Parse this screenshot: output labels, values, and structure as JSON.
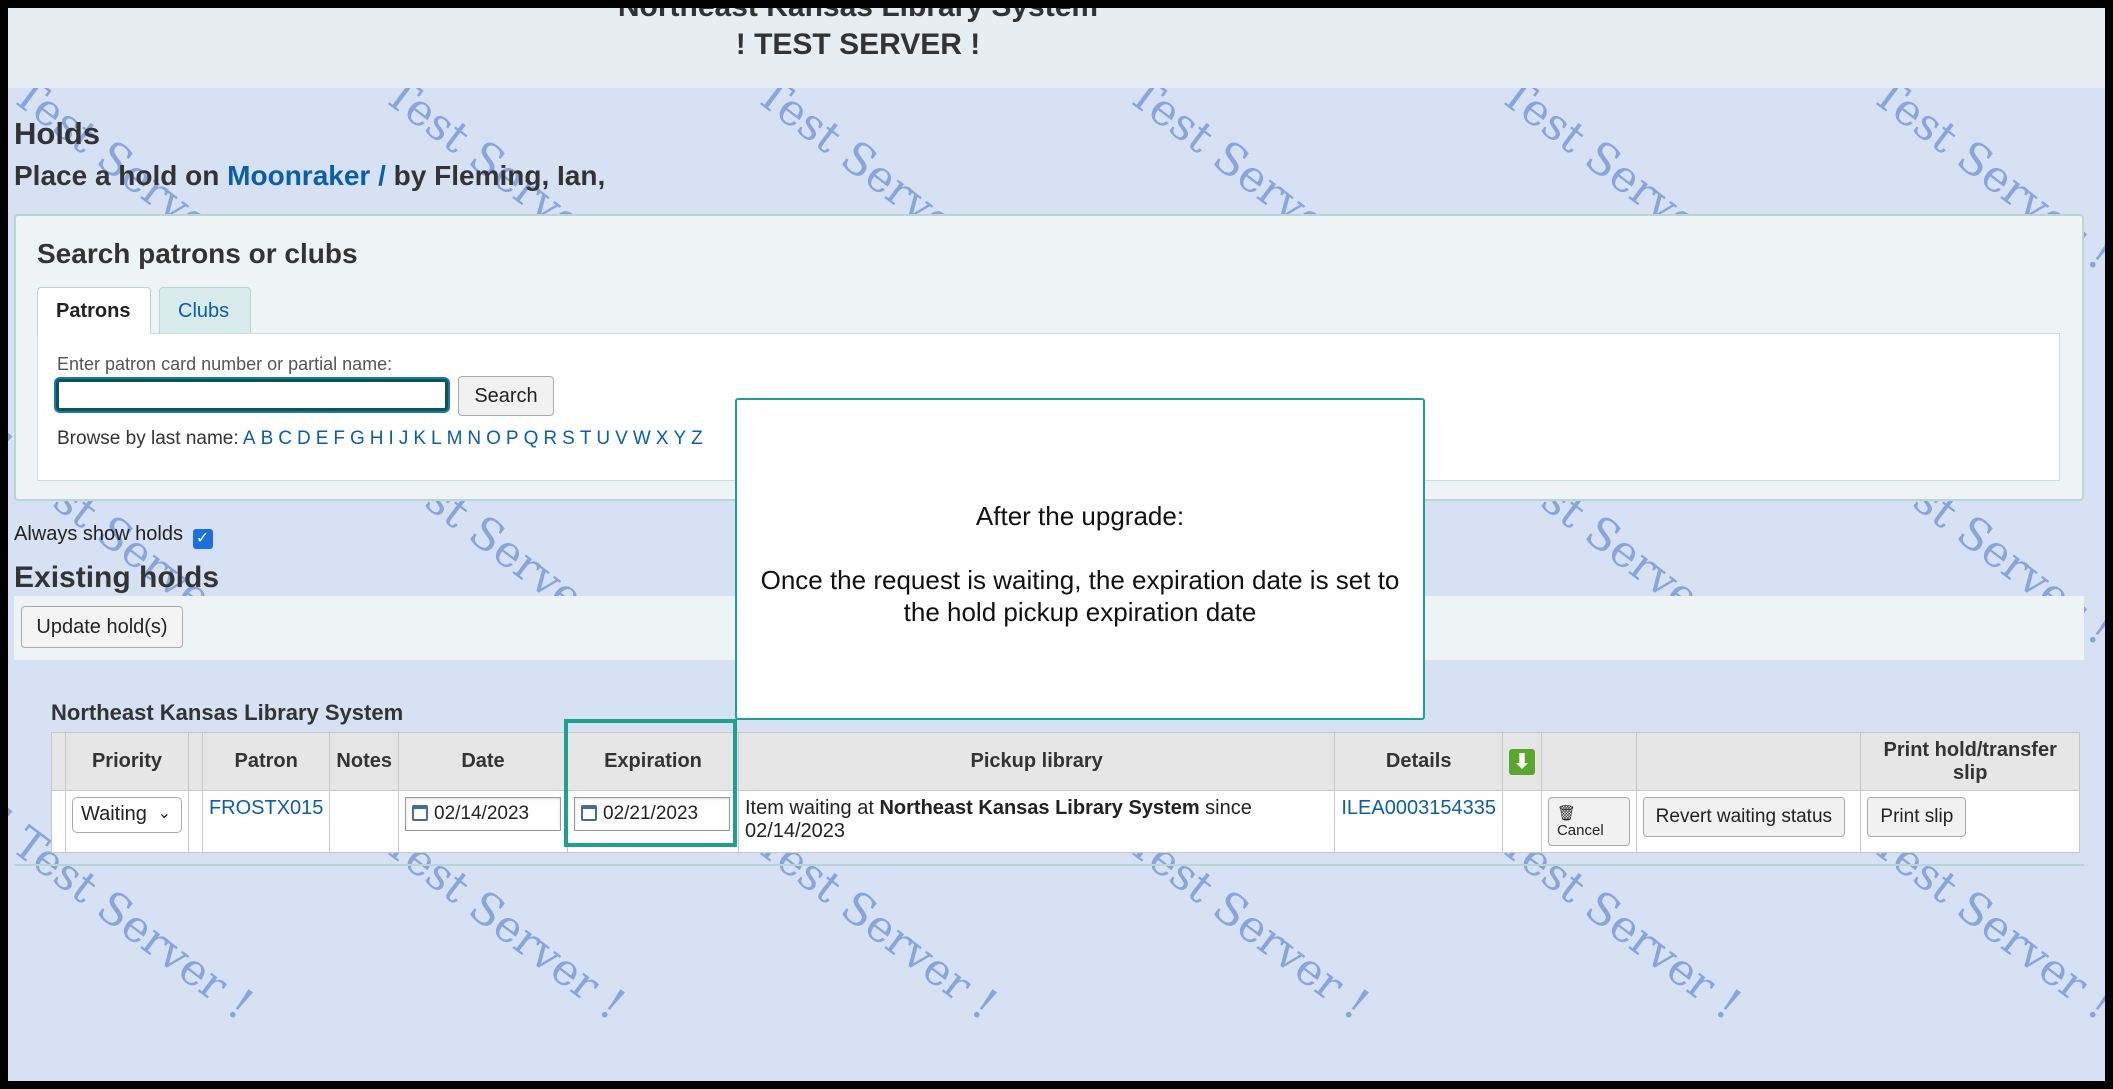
{
  "header": {
    "library_name": "Northeast Kansas Library System",
    "server_banner": "! TEST SERVER !"
  },
  "watermark": {
    "text": "! Test Server !"
  },
  "page": {
    "title": "Holds",
    "place_hold_prefix": "Place a hold on",
    "book_link": "Moonraker /",
    "author": "by Fleming, Ian,"
  },
  "search": {
    "heading": "Search patrons or clubs",
    "tabs": [
      {
        "label": "Patrons"
      },
      {
        "label": "Clubs"
      }
    ],
    "field_label": "Enter patron card number or partial name:",
    "input_value": "",
    "search_button": "Search",
    "browse_label": "Browse by last name:",
    "letters": [
      "A",
      "B",
      "C",
      "D",
      "E",
      "F",
      "G",
      "H",
      "I",
      "J",
      "K",
      "L",
      "M",
      "N",
      "O",
      "P",
      "Q",
      "R",
      "S",
      "T",
      "U",
      "V",
      "W",
      "X",
      "Y",
      "Z"
    ]
  },
  "always_show_holds": {
    "label": "Always show holds",
    "checked": true
  },
  "existing_holds": {
    "heading": "Existing holds",
    "update_button": "Update hold(s)",
    "branch": "Northeast Kansas Library System",
    "columns": [
      "Priority",
      "Patron",
      "Notes",
      "Date",
      "Expiration",
      "Pickup library",
      "Details",
      "Print hold/transfer slip"
    ],
    "rows": [
      {
        "priority": "Waiting",
        "patron": "FROSTX015",
        "notes": "",
        "date": "02/14/2023",
        "expiration": "02/21/2023",
        "pickup_prefix": "Item waiting at",
        "pickup_library": "Northeast Kansas Library System",
        "pickup_since": "since 02/14/2023",
        "details": "ILEA0003154335",
        "cancel_button": "Cancel",
        "revert_button": "Revert waiting status",
        "print_button": "Print slip"
      }
    ]
  },
  "callout": {
    "title": "After the upgrade:",
    "body": "Once the request is waiting, the expiration date is set to the hold pickup expiration date"
  },
  "colors": {
    "accent_highlight": "#1fa08f",
    "link": "#0b5ea8",
    "background": "#d6e2f4"
  }
}
